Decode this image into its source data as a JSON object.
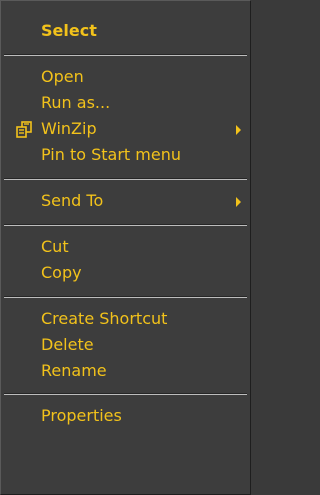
{
  "menu": {
    "select": "Select",
    "open": "Open",
    "run_as": "Run as...",
    "winzip": "WinZip",
    "pin_to_start": "Pin to Start menu",
    "send_to": "Send To",
    "cut": "Cut",
    "copy": "Copy",
    "create_shortcut": "Create Shortcut",
    "delete": "Delete",
    "rename": "Rename",
    "properties": "Properties"
  },
  "icons": {
    "winzip": "winzip-icon",
    "submenu_arrow": "submenu-arrow-icon"
  },
  "colors": {
    "text": "#f2c21b",
    "background": "#3d3d3d"
  }
}
